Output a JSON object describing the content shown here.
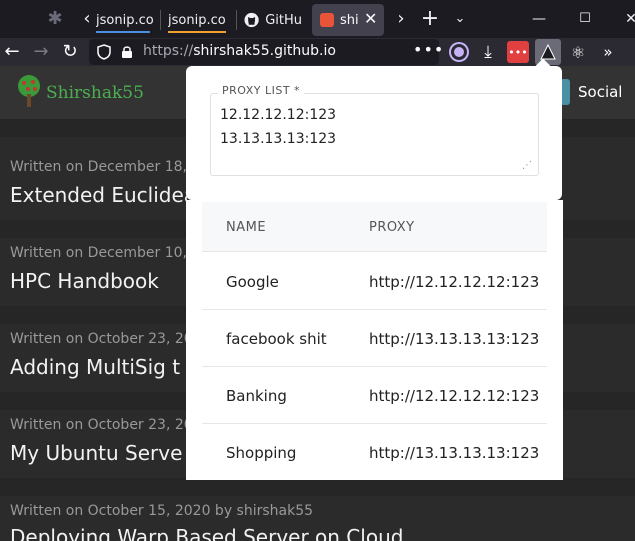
{
  "tabs": [
    {
      "label": "jsonip.co",
      "underline": "#4a90e2"
    },
    {
      "label": "jsonip.co",
      "underline": "#f0a030"
    },
    {
      "label": "GitHu"
    },
    {
      "label": "shi"
    }
  ],
  "url": {
    "prefix": "https://",
    "host": "shirshak55.github.io"
  },
  "site": {
    "logo": "Shirshak55",
    "nav_social": "Social"
  },
  "posts": [
    {
      "meta": "Written on December 18,",
      "title": "Extended Euclidea"
    },
    {
      "meta": "Written on December 10,",
      "title": "HPC Handbook"
    },
    {
      "meta": "Written on October 23, 20",
      "title": "Adding MultiSig t"
    },
    {
      "meta": "Written on October 23, 20",
      "title": "My Ubuntu Serve"
    },
    {
      "meta": "Written on October 15, 2020 by shirshak55",
      "title": "Deploying Warp Based Server on Cloud"
    }
  ],
  "popup": {
    "legend": "PROXY LIST *",
    "proxy_list": [
      "12.12.12.12:123",
      "13.13.13.13:123"
    ],
    "columns": [
      "NAME",
      "PROXY"
    ],
    "rows": [
      {
        "name": "Google",
        "proxy": "http://12.12.12.12:123"
      },
      {
        "name": "facebook shit",
        "proxy": "http://13.13.13.13:123"
      },
      {
        "name": "Banking",
        "proxy": "http://12.12.12.12:123"
      },
      {
        "name": "Shopping",
        "proxy": "http://13.13.13.13:123"
      }
    ]
  },
  "colors": {
    "browser_bg": "#1c1b22",
    "toolbar": "#2b2a33",
    "page_bg": "#2b2b2b",
    "logo_green": "#4caf50"
  }
}
